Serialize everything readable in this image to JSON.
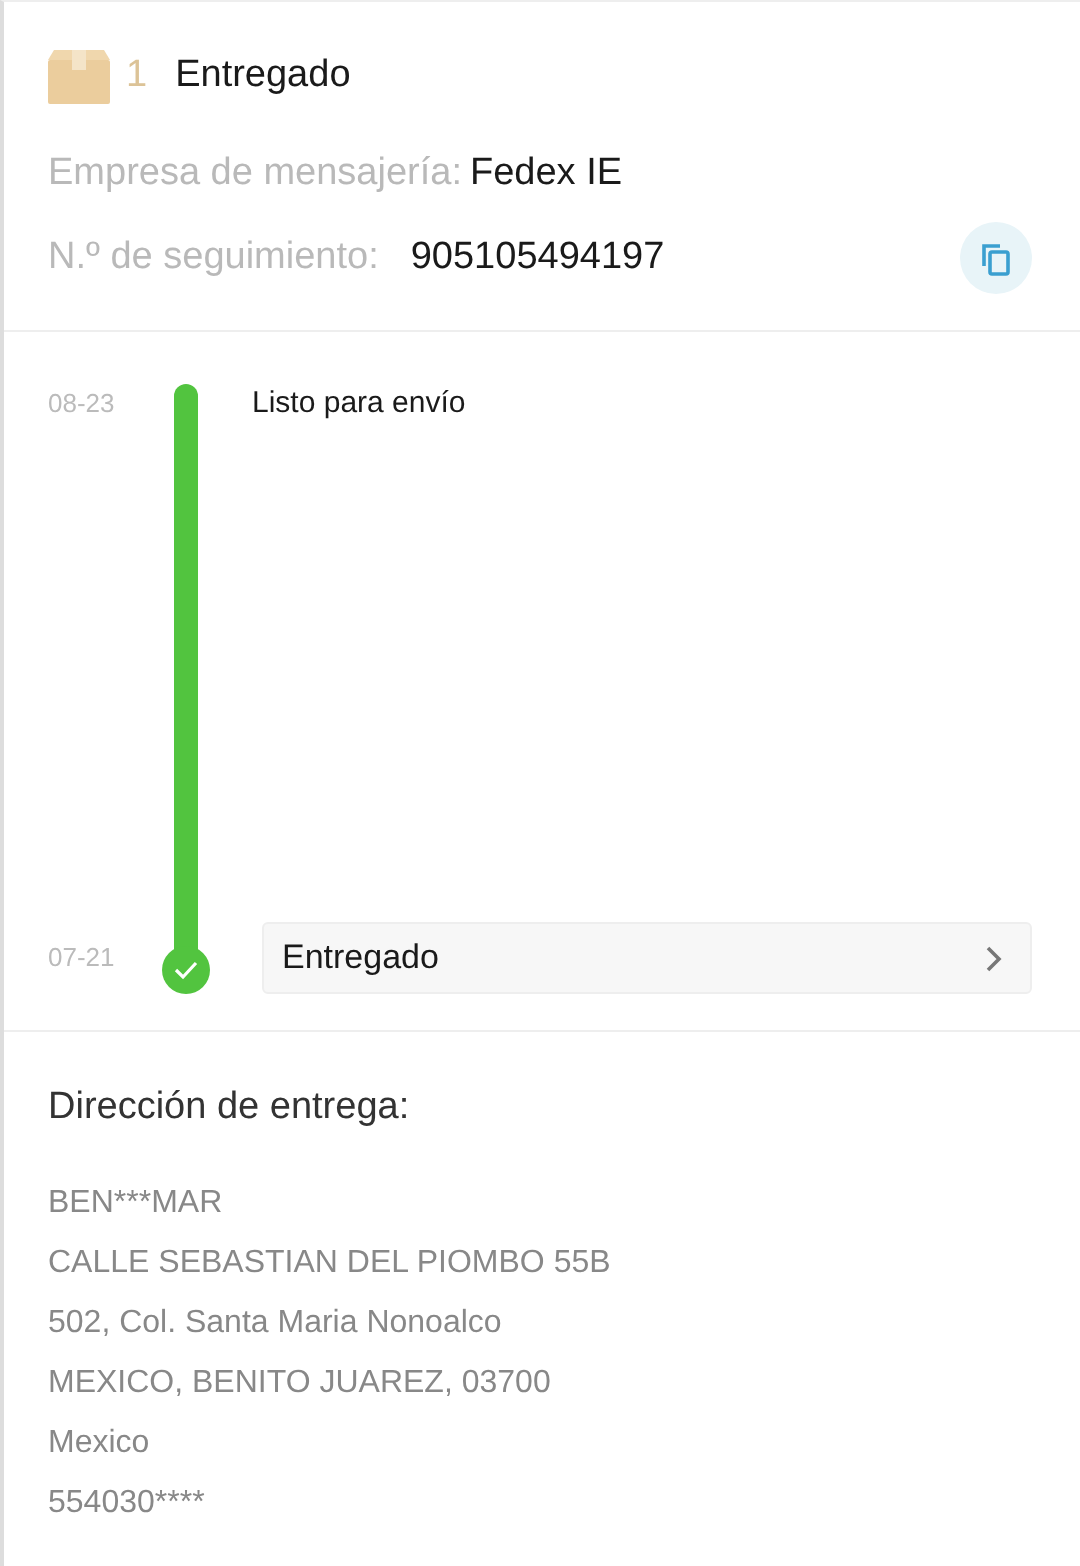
{
  "shipment": {
    "count": "1",
    "status": "Entregado",
    "carrier_label": "Empresa de mensajería:",
    "carrier": "Fedex IE",
    "tracking_label": "N.º de seguimiento:",
    "tracking_number": "905105494197"
  },
  "timeline": [
    {
      "date": "08-23",
      "text": "Listo para envío",
      "kind": "plain"
    },
    {
      "date": "07-21",
      "text": "Entregado",
      "kind": "bubble"
    }
  ],
  "address": {
    "title": "Dirección de entrega:",
    "lines": [
      "BEN***MAR",
      "CALLE SEBASTIAN DEL PIOMBO 55B",
      "502, Col. Santa Maria Nonoalco",
      "MEXICO, BENITO JUAREZ, 03700",
      "Mexico",
      "554030****"
    ]
  }
}
